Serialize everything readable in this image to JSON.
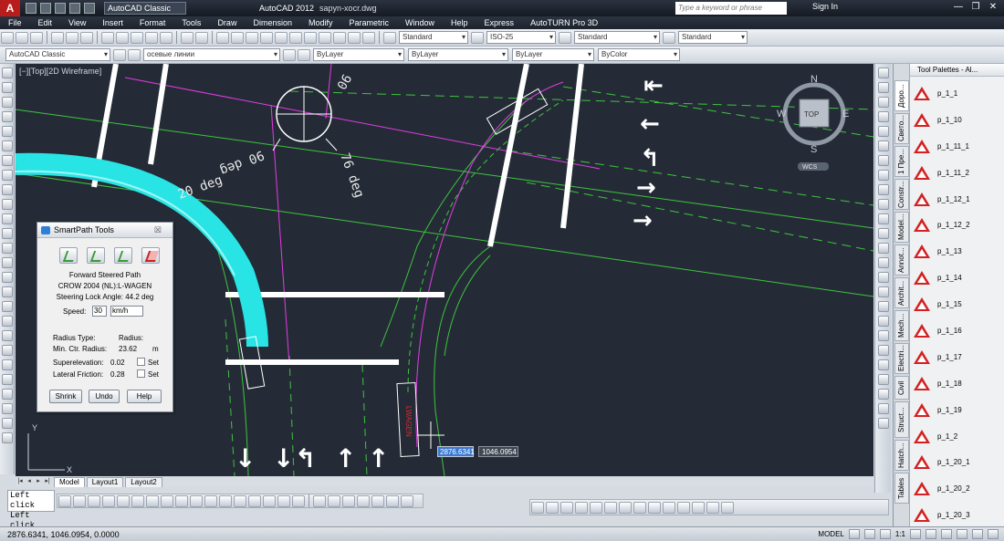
{
  "titlebar": {
    "workspace": "AutoCAD Classic",
    "app_title": "AutoCAD 2012",
    "file_name": "sapyn-xocr.dwg",
    "search_placeholder": "Type a keyword or phrase",
    "signin": "Sign In"
  },
  "menu": [
    "File",
    "Edit",
    "View",
    "Insert",
    "Format",
    "Tools",
    "Draw",
    "Dimension",
    "Modify",
    "Parametric",
    "Window",
    "Help",
    "Express",
    "AutoTURN Pro 3D"
  ],
  "toolbar1": {
    "text_style": "Standard",
    "dim_style": "ISO-25",
    "table_style": "Standard",
    "multileader_style": "Standard"
  },
  "toolbar2": {
    "workspace": "AutoCAD Classic",
    "layer": "осевые линии",
    "color": "ByLayer",
    "linetype": "ByLayer",
    "lineweight": "ByLayer",
    "plot_style": "ByColor"
  },
  "viewport": {
    "label": "[−][Top][2D Wireframe]",
    "viewcube_top": "TOP",
    "compass": {
      "n": "N",
      "s": "S",
      "e": "E",
      "w": "W"
    },
    "wcs": "WCS",
    "angle_a": "90",
    "angle_b": "20 deg",
    "angle_c": "76 deg",
    "angle_d": "90 deg",
    "vehicle_text": "LWAGEN",
    "axis_y": "Y",
    "axis_x": "X"
  },
  "dynamic_input": {
    "x": "2876.6341",
    "y": "1046.0954"
  },
  "layout_tabs": [
    "Model",
    "Layout1",
    "Layout2"
  ],
  "cmdline": [
    "Left click",
    "Left click"
  ],
  "status": {
    "coords": "2876.6341, 1046.0954, 0.0000",
    "model": "MODEL",
    "scale": "1:1"
  },
  "smartpath": {
    "title": "SmartPath Tools",
    "close": "☒",
    "heading": "Forward Steered Path",
    "vehicle": "CROW 2004 (NL):L-WAGEN",
    "steering": "Steering Lock Angle: 44.2 deg",
    "speed_label": "Speed:",
    "speed_value": "30",
    "speed_unit": "km/h",
    "radius_type_label": "Radius Type:",
    "radius_label": "Radius:",
    "min_ctr_label": "Min. Ctr. Radius:",
    "min_ctr_value": "23.62",
    "min_ctr_unit": "m",
    "superelev_label": "Superelevation:",
    "superelev_value": "0.02",
    "lat_friction_label": "Lateral Friction:",
    "lat_friction_value": "0.28",
    "set_label": "Set",
    "shrink": "Shrink",
    "undo": "Undo",
    "help": "Help"
  },
  "palette": {
    "title": "Tool Palettes - Al...",
    "side_tabs": [
      "Доро...",
      "Свето...",
      "1 Пре...",
      "Constr...",
      "Model...",
      "Annot...",
      "Archit...",
      "Mech...",
      "Electri...",
      "Civil",
      "Struct...",
      "Hatch...",
      "Tables"
    ],
    "items": [
      "p_1_1",
      "p_1_10",
      "p_1_11_1",
      "p_1_11_2",
      "p_1_12_1",
      "p_1_12_2",
      "p_1_13",
      "p_1_14",
      "p_1_15",
      "p_1_16",
      "p_1_17",
      "p_1_18",
      "p_1_19",
      "p_1_2",
      "p_1_20_1",
      "p_1_20_2",
      "p_1_20_3"
    ],
    "accent": "#d42020"
  }
}
